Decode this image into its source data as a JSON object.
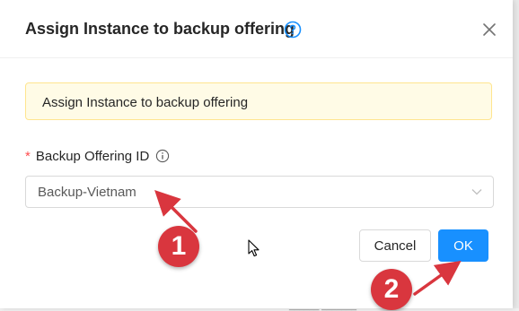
{
  "modal": {
    "title": "Assign Instance to backup offering",
    "alert_text": "Assign Instance to backup offering",
    "field": {
      "required_mark": "*",
      "label": "Backup Offering ID",
      "selected_value": "Backup-Vietnam"
    },
    "buttons": {
      "cancel_label": "Cancel",
      "ok_label": "OK"
    }
  },
  "annotations": {
    "step1": "1",
    "step2": "2",
    "bottom_partial_text": "______ _______"
  },
  "icons": {
    "help": "question-circle-icon",
    "close": "close-icon",
    "info": "info-circle-icon",
    "dropdown": "chevron-down-icon",
    "cursor": "mouse-pointer-icon"
  },
  "colors": {
    "primary": "#1890ff",
    "alert_bg": "#fffbe6",
    "alert_border": "#ffe58f",
    "required": "#ff4d4f",
    "annotation": "#d9363e"
  }
}
